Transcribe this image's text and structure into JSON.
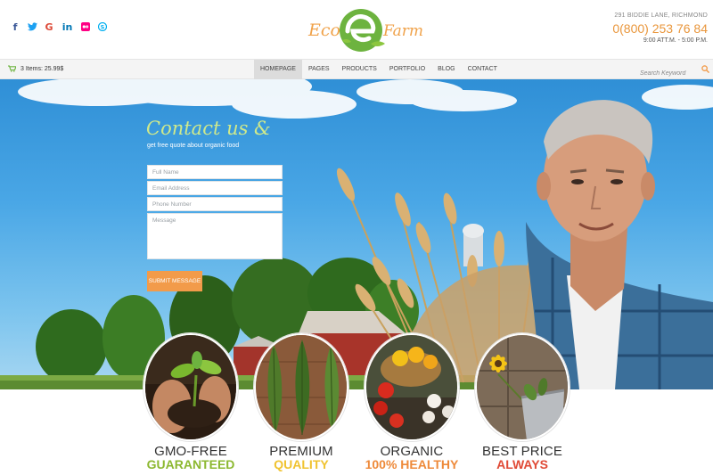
{
  "header": {
    "socials": [
      {
        "icon": "facebook-icon",
        "glyph": "f",
        "color": "#3b5998"
      },
      {
        "icon": "twitter-icon",
        "glyph": "t",
        "color": "#1da1f2"
      },
      {
        "icon": "google-icon",
        "glyph": "G",
        "color": "#dd4b39"
      },
      {
        "icon": "linkedin-icon",
        "glyph": "in",
        "color": "#0077b5"
      },
      {
        "icon": "flickr-icon",
        "glyph": "●",
        "color": "#ff0084"
      },
      {
        "icon": "skype-icon",
        "glyph": "S",
        "color": "#00aff0"
      }
    ],
    "logo": {
      "left": "Eco",
      "right": "Farm"
    },
    "address": "291 BIDDIE LANE, RICHMOND",
    "phone": "0(800) 253 76 84",
    "hours": "9:00 ATT.M. - 5:00 P.M."
  },
  "nav": {
    "cart": "3 Items: 25.99$",
    "items": [
      "HOMEPAGE",
      "PAGES",
      "PRODUCTS",
      "PORTFOLIO",
      "BLOG",
      "CONTACT"
    ],
    "active": "HOMEPAGE",
    "search_placeholder": "Search Keyword"
  },
  "contact_form": {
    "title": "Contact us &",
    "subtitle": "get free quote about organic food",
    "name_placeholder": "Full Name",
    "email_placeholder": "Email Address",
    "phone_placeholder": "Phone Number",
    "message_placeholder": "Message",
    "submit_label": "SUBMIT MESSAGE"
  },
  "features": [
    {
      "top": "GMO-FREE",
      "bottom": "GUARANTEED",
      "color": "#8cb830"
    },
    {
      "top": "PREMIUM",
      "bottom": "QUALITY",
      "color": "#f0c330"
    },
    {
      "top": "ORGANIC",
      "bottom": "100% HEALTHY",
      "color": "#ee8a3a"
    },
    {
      "top": "BEST PRICE",
      "bottom": "ALWAYS",
      "color": "#e04a36"
    }
  ],
  "colors": {
    "accent": "#f29b4a",
    "brand_green": "#6db33f"
  }
}
